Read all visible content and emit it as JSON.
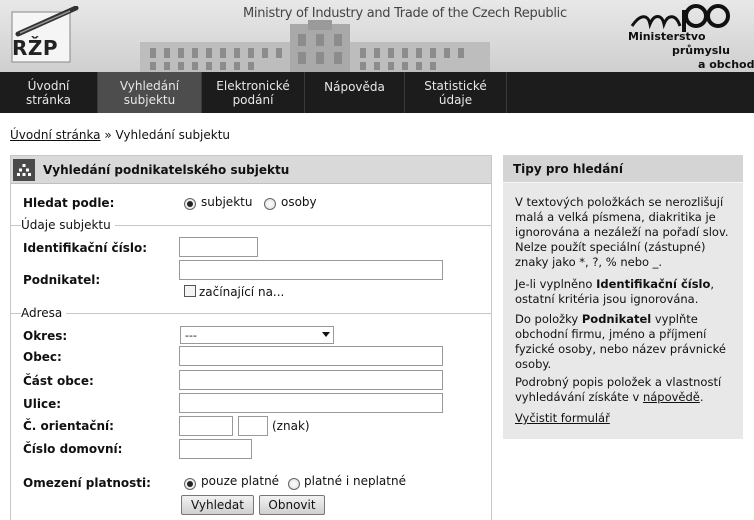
{
  "header": {
    "title": "Ministry of Industry and Trade of the Czech Republic",
    "rzp_logo_text": "RŽP",
    "mpo_logo_text": "mpo",
    "mpo_lines": [
      "Ministerstvo",
      "průmyslu",
      "a obchodu"
    ]
  },
  "nav": {
    "items": [
      {
        "line1": "Úvodní",
        "line2": "stránka"
      },
      {
        "line1": "Vyhledání",
        "line2": "subjektu"
      },
      {
        "line1": "Elektronické",
        "line2": "podání"
      },
      {
        "line1": "Nápověda",
        "line2": ""
      },
      {
        "line1": "Statistické",
        "line2": "údaje"
      }
    ]
  },
  "breadcrumb": {
    "home": "Úvodní stránka",
    "separator": "»",
    "current": "Vyhledání subjektu"
  },
  "form": {
    "title": "Vyhledání podnikatelského subjektu",
    "search_by_label": "Hledat podle:",
    "search_by_options": [
      "subjektu",
      "osoby"
    ],
    "search_by_selected": "subjektu",
    "section_subject": "Údaje subjektu",
    "ico_label": "Identifikační číslo:",
    "ico_value": "",
    "podnikatel_label": "Podnikatel:",
    "podnikatel_value": "",
    "starts_with_label": "začínající na...",
    "section_address": "Adresa",
    "okres_label": "Okres:",
    "okres_value": "---",
    "obec_label": "Obec:",
    "cast_obce_label": "Část obce:",
    "ulice_label": "Ulice:",
    "c_orientacni_label": "Č. orientační:",
    "znak_label": "(znak)",
    "cislo_domovni_label": "Číslo domovní:",
    "omezeni_label": "Omezení platnosti:",
    "omezeni_options": [
      "pouze platné",
      "platné i neplatné"
    ],
    "omezeni_selected": "pouze platné",
    "search_button": "Vyhledat",
    "refresh_button": "Obnovit"
  },
  "tips": {
    "title": "Tipy pro hledání",
    "p1": "V textových položkách se nerozlišují malá a velká písmena, diakritika je ignorována a nezáleží na pořadí slov.",
    "p2": "Nelze použít speciální (zástupné) znaky jako *, ?, % nebo _.",
    "p3_pre": "Je-li vyplněno ",
    "p3_bold": "Identifikační číslo",
    "p3_post": ", ostatní kritéria jsou ignorována.",
    "p4_pre": "Do položky ",
    "p4_bold": "Podnikatel",
    "p4_post": " vyplňte obchodní firmu, jméno a příjmení fyzické osoby, nebo název právnické osoby.",
    "p5_pre": "Podrobný popis položek a vlastností vyhledávání získáte v ",
    "p5_link": "nápovědě",
    "p5_post": ".",
    "clear_link": "Vyčistit formulář"
  }
}
